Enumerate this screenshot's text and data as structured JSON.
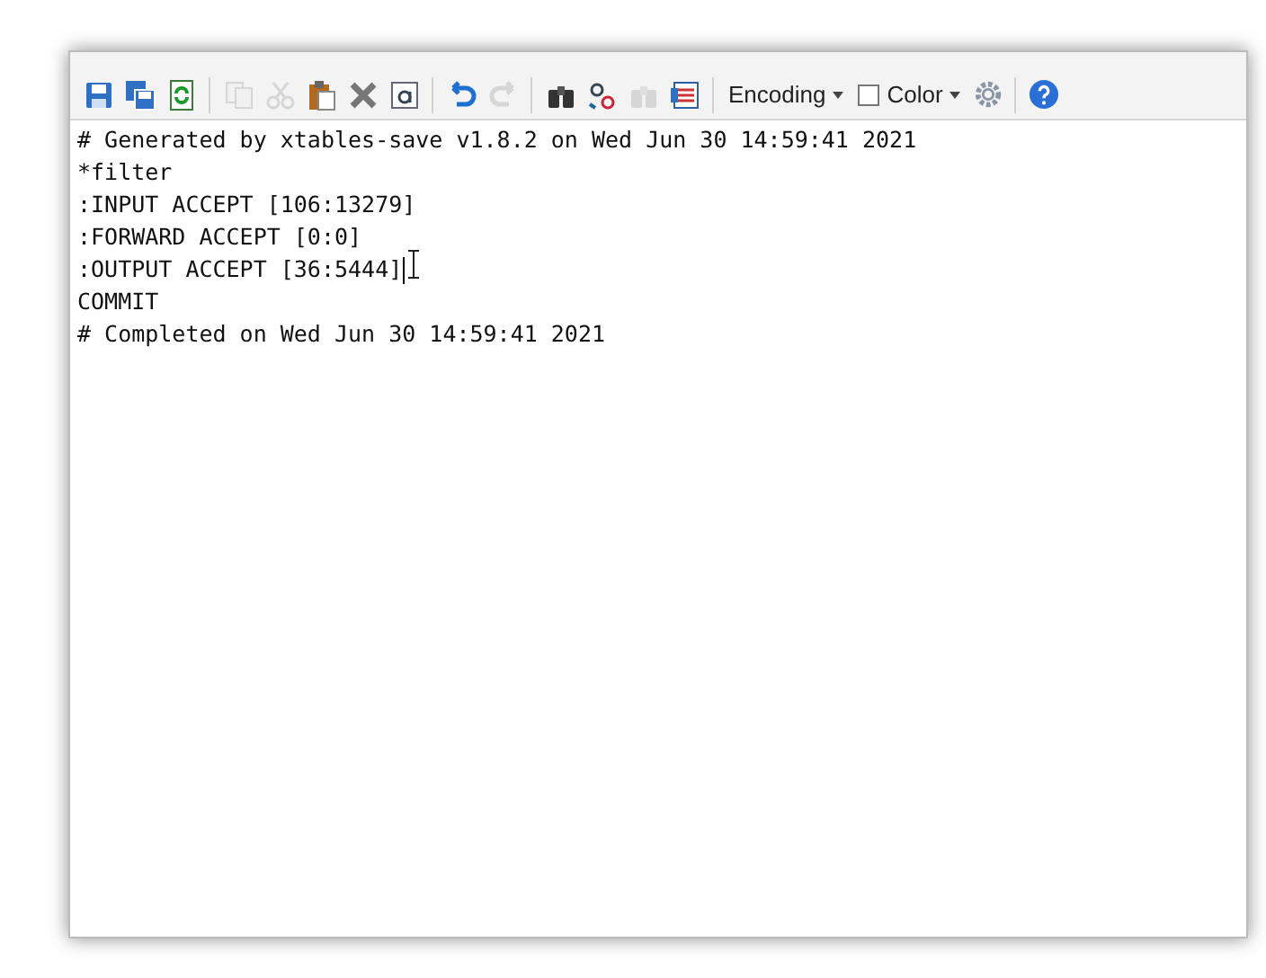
{
  "toolbar": {
    "buttons": [
      {
        "disabled": false
      },
      {
        "disabled": false
      },
      {
        "disabled": false
      },
      {
        "disabled": true
      },
      {
        "disabled": true
      },
      {
        "disabled": false
      },
      {
        "disabled": false
      },
      {
        "disabled": false
      },
      {
        "disabled": false
      },
      {
        "disabled": true
      },
      {
        "disabled": false
      },
      {
        "disabled": false
      },
      {
        "disabled": true
      },
      {
        "disabled": false
      }
    ],
    "encoding": {
      "label": "Encoding"
    },
    "color": {
      "label": "Color",
      "checked": false
    }
  },
  "editor": {
    "lines": [
      {
        "text": "# Generated by xtables-save v1.8.2 on Wed Jun 30 14:59:41 2021",
        "cursor": false
      },
      {
        "text": "*filter",
        "cursor": false
      },
      {
        "text": ":INPUT ACCEPT [106:13279]",
        "cursor": false
      },
      {
        "text": ":FORWARD ACCEPT [0:0]",
        "cursor": false
      },
      {
        "text": ":OUTPUT ACCEPT [36:5444]",
        "cursor": true
      },
      {
        "text": "COMMIT",
        "cursor": false
      },
      {
        "text": "# Completed on Wed Jun 30 14:59:41 2021",
        "cursor": false
      }
    ]
  }
}
